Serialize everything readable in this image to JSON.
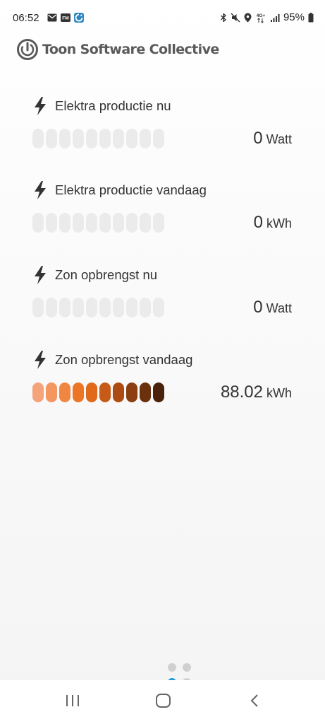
{
  "status_bar": {
    "time": "06:52",
    "notification_icons": [
      "mail-icon",
      "fm-radio-icon",
      "app-icon"
    ],
    "system_icons": [
      "bluetooth-icon",
      "mute-icon",
      "location-icon",
      "4g-data-icon",
      "signal-icon"
    ],
    "battery_percent": "95%",
    "network_label": "4G+",
    "fm_label": "FM"
  },
  "header": {
    "title": "Toon Software Collective"
  },
  "colors": {
    "inactive_segment": "#ebebeb",
    "active_segments": [
      "#f5a37b",
      "#f3965f",
      "#ef8743",
      "#ec7626",
      "#e0691c",
      "#c75a17",
      "#ac4c13",
      "#8c3e10",
      "#6b300c",
      "#4a210a"
    ]
  },
  "metrics": [
    {
      "label": "Elektra productie nu",
      "value": "0",
      "unit": "Watt",
      "level": 0,
      "icon": "lightning-bolt-icon"
    },
    {
      "label": "Elektra productie vandaag",
      "value": "0",
      "unit": "kWh",
      "level": 0,
      "icon": "lightning-bolt-icon"
    },
    {
      "label": "Zon opbrengst nu",
      "value": "0",
      "unit": "Watt",
      "level": 0,
      "icon": "lightning-bolt-icon"
    },
    {
      "label": "Zon opbrengst vandaag",
      "value": "88.02",
      "unit": "kWh",
      "level": 10,
      "icon": "lightning-bolt-icon"
    }
  ],
  "meter_segments": 10,
  "page_indicator": {
    "pages": 4,
    "active_index": 2
  },
  "nav_bar": {
    "buttons": [
      "recent-apps-icon",
      "home-icon",
      "back-icon"
    ]
  }
}
